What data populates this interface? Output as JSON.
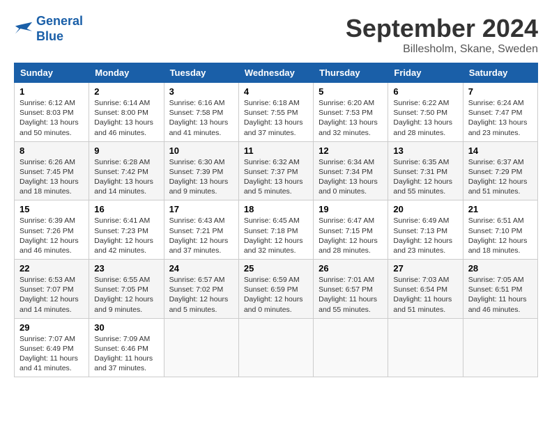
{
  "logo": {
    "line1": "General",
    "line2": "Blue"
  },
  "title": "September 2024",
  "location": "Billesholm, Skane, Sweden",
  "days_of_week": [
    "Sunday",
    "Monday",
    "Tuesday",
    "Wednesday",
    "Thursday",
    "Friday",
    "Saturday"
  ],
  "weeks": [
    [
      {
        "day": "1",
        "detail": "Sunrise: 6:12 AM\nSunset: 8:03 PM\nDaylight: 13 hours\nand 50 minutes."
      },
      {
        "day": "2",
        "detail": "Sunrise: 6:14 AM\nSunset: 8:00 PM\nDaylight: 13 hours\nand 46 minutes."
      },
      {
        "day": "3",
        "detail": "Sunrise: 6:16 AM\nSunset: 7:58 PM\nDaylight: 13 hours\nand 41 minutes."
      },
      {
        "day": "4",
        "detail": "Sunrise: 6:18 AM\nSunset: 7:55 PM\nDaylight: 13 hours\nand 37 minutes."
      },
      {
        "day": "5",
        "detail": "Sunrise: 6:20 AM\nSunset: 7:53 PM\nDaylight: 13 hours\nand 32 minutes."
      },
      {
        "day": "6",
        "detail": "Sunrise: 6:22 AM\nSunset: 7:50 PM\nDaylight: 13 hours\nand 28 minutes."
      },
      {
        "day": "7",
        "detail": "Sunrise: 6:24 AM\nSunset: 7:47 PM\nDaylight: 13 hours\nand 23 minutes."
      }
    ],
    [
      {
        "day": "8",
        "detail": "Sunrise: 6:26 AM\nSunset: 7:45 PM\nDaylight: 13 hours\nand 18 minutes."
      },
      {
        "day": "9",
        "detail": "Sunrise: 6:28 AM\nSunset: 7:42 PM\nDaylight: 13 hours\nand 14 minutes."
      },
      {
        "day": "10",
        "detail": "Sunrise: 6:30 AM\nSunset: 7:39 PM\nDaylight: 13 hours\nand 9 minutes."
      },
      {
        "day": "11",
        "detail": "Sunrise: 6:32 AM\nSunset: 7:37 PM\nDaylight: 13 hours\nand 5 minutes."
      },
      {
        "day": "12",
        "detail": "Sunrise: 6:34 AM\nSunset: 7:34 PM\nDaylight: 13 hours\nand 0 minutes."
      },
      {
        "day": "13",
        "detail": "Sunrise: 6:35 AM\nSunset: 7:31 PM\nDaylight: 12 hours\nand 55 minutes."
      },
      {
        "day": "14",
        "detail": "Sunrise: 6:37 AM\nSunset: 7:29 PM\nDaylight: 12 hours\nand 51 minutes."
      }
    ],
    [
      {
        "day": "15",
        "detail": "Sunrise: 6:39 AM\nSunset: 7:26 PM\nDaylight: 12 hours\nand 46 minutes."
      },
      {
        "day": "16",
        "detail": "Sunrise: 6:41 AM\nSunset: 7:23 PM\nDaylight: 12 hours\nand 42 minutes."
      },
      {
        "day": "17",
        "detail": "Sunrise: 6:43 AM\nSunset: 7:21 PM\nDaylight: 12 hours\nand 37 minutes."
      },
      {
        "day": "18",
        "detail": "Sunrise: 6:45 AM\nSunset: 7:18 PM\nDaylight: 12 hours\nand 32 minutes."
      },
      {
        "day": "19",
        "detail": "Sunrise: 6:47 AM\nSunset: 7:15 PM\nDaylight: 12 hours\nand 28 minutes."
      },
      {
        "day": "20",
        "detail": "Sunrise: 6:49 AM\nSunset: 7:13 PM\nDaylight: 12 hours\nand 23 minutes."
      },
      {
        "day": "21",
        "detail": "Sunrise: 6:51 AM\nSunset: 7:10 PM\nDaylight: 12 hours\nand 18 minutes."
      }
    ],
    [
      {
        "day": "22",
        "detail": "Sunrise: 6:53 AM\nSunset: 7:07 PM\nDaylight: 12 hours\nand 14 minutes."
      },
      {
        "day": "23",
        "detail": "Sunrise: 6:55 AM\nSunset: 7:05 PM\nDaylight: 12 hours\nand 9 minutes."
      },
      {
        "day": "24",
        "detail": "Sunrise: 6:57 AM\nSunset: 7:02 PM\nDaylight: 12 hours\nand 5 minutes."
      },
      {
        "day": "25",
        "detail": "Sunrise: 6:59 AM\nSunset: 6:59 PM\nDaylight: 12 hours\nand 0 minutes."
      },
      {
        "day": "26",
        "detail": "Sunrise: 7:01 AM\nSunset: 6:57 PM\nDaylight: 11 hours\nand 55 minutes."
      },
      {
        "day": "27",
        "detail": "Sunrise: 7:03 AM\nSunset: 6:54 PM\nDaylight: 11 hours\nand 51 minutes."
      },
      {
        "day": "28",
        "detail": "Sunrise: 7:05 AM\nSunset: 6:51 PM\nDaylight: 11 hours\nand 46 minutes."
      }
    ],
    [
      {
        "day": "29",
        "detail": "Sunrise: 7:07 AM\nSunset: 6:49 PM\nDaylight: 11 hours\nand 41 minutes."
      },
      {
        "day": "30",
        "detail": "Sunrise: 7:09 AM\nSunset: 6:46 PM\nDaylight: 11 hours\nand 37 minutes."
      },
      null,
      null,
      null,
      null,
      null
    ]
  ]
}
